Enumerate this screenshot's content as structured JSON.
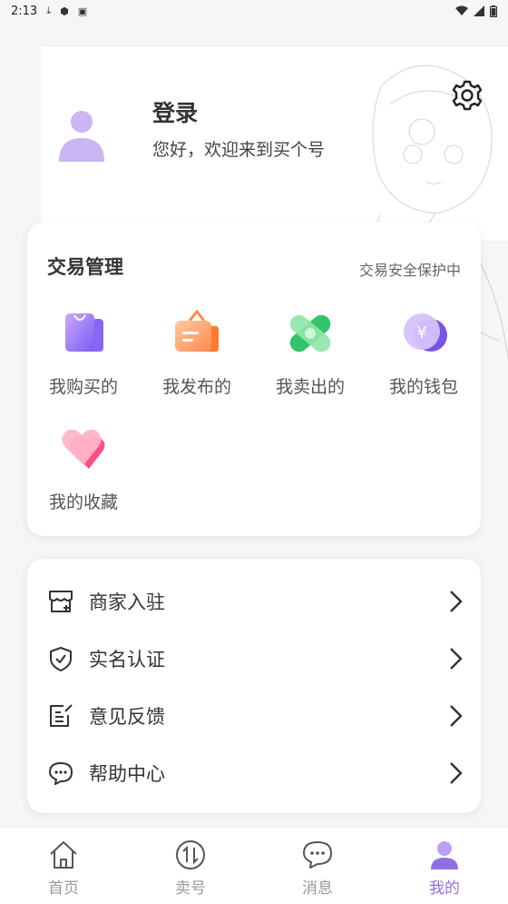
{
  "status_bar": {
    "time": "2:13"
  },
  "header": {
    "login_title": "登录",
    "welcome_text": "您好，欢迎来到买个号"
  },
  "trade": {
    "title": "交易管理",
    "safe_note": "交易安全保护中",
    "items": [
      {
        "label": "我购买的",
        "icon": "shopping-bag-icon"
      },
      {
        "label": "我发布的",
        "icon": "publish-board-icon"
      },
      {
        "label": "我卖出的",
        "icon": "sold-tag-icon"
      },
      {
        "label": "我的钱包",
        "icon": "wallet-yen-icon"
      },
      {
        "label": "我的收藏",
        "icon": "heart-icon"
      }
    ]
  },
  "menu": [
    {
      "label": "商家入驻",
      "icon": "store-icon"
    },
    {
      "label": "实名认证",
      "icon": "shield-check-icon"
    },
    {
      "label": "意见反馈",
      "icon": "feedback-icon"
    },
    {
      "label": "帮助中心",
      "icon": "help-chat-icon"
    }
  ],
  "nav": [
    {
      "label": "首页",
      "icon": "home-icon"
    },
    {
      "label": "卖号",
      "icon": "exchange-icon"
    },
    {
      "label": "消息",
      "icon": "message-icon"
    },
    {
      "label": "我的",
      "icon": "profile-icon",
      "active": true
    }
  ],
  "colors": {
    "accent": "#8f6fe6",
    "avatar": "#c9b6f2"
  }
}
